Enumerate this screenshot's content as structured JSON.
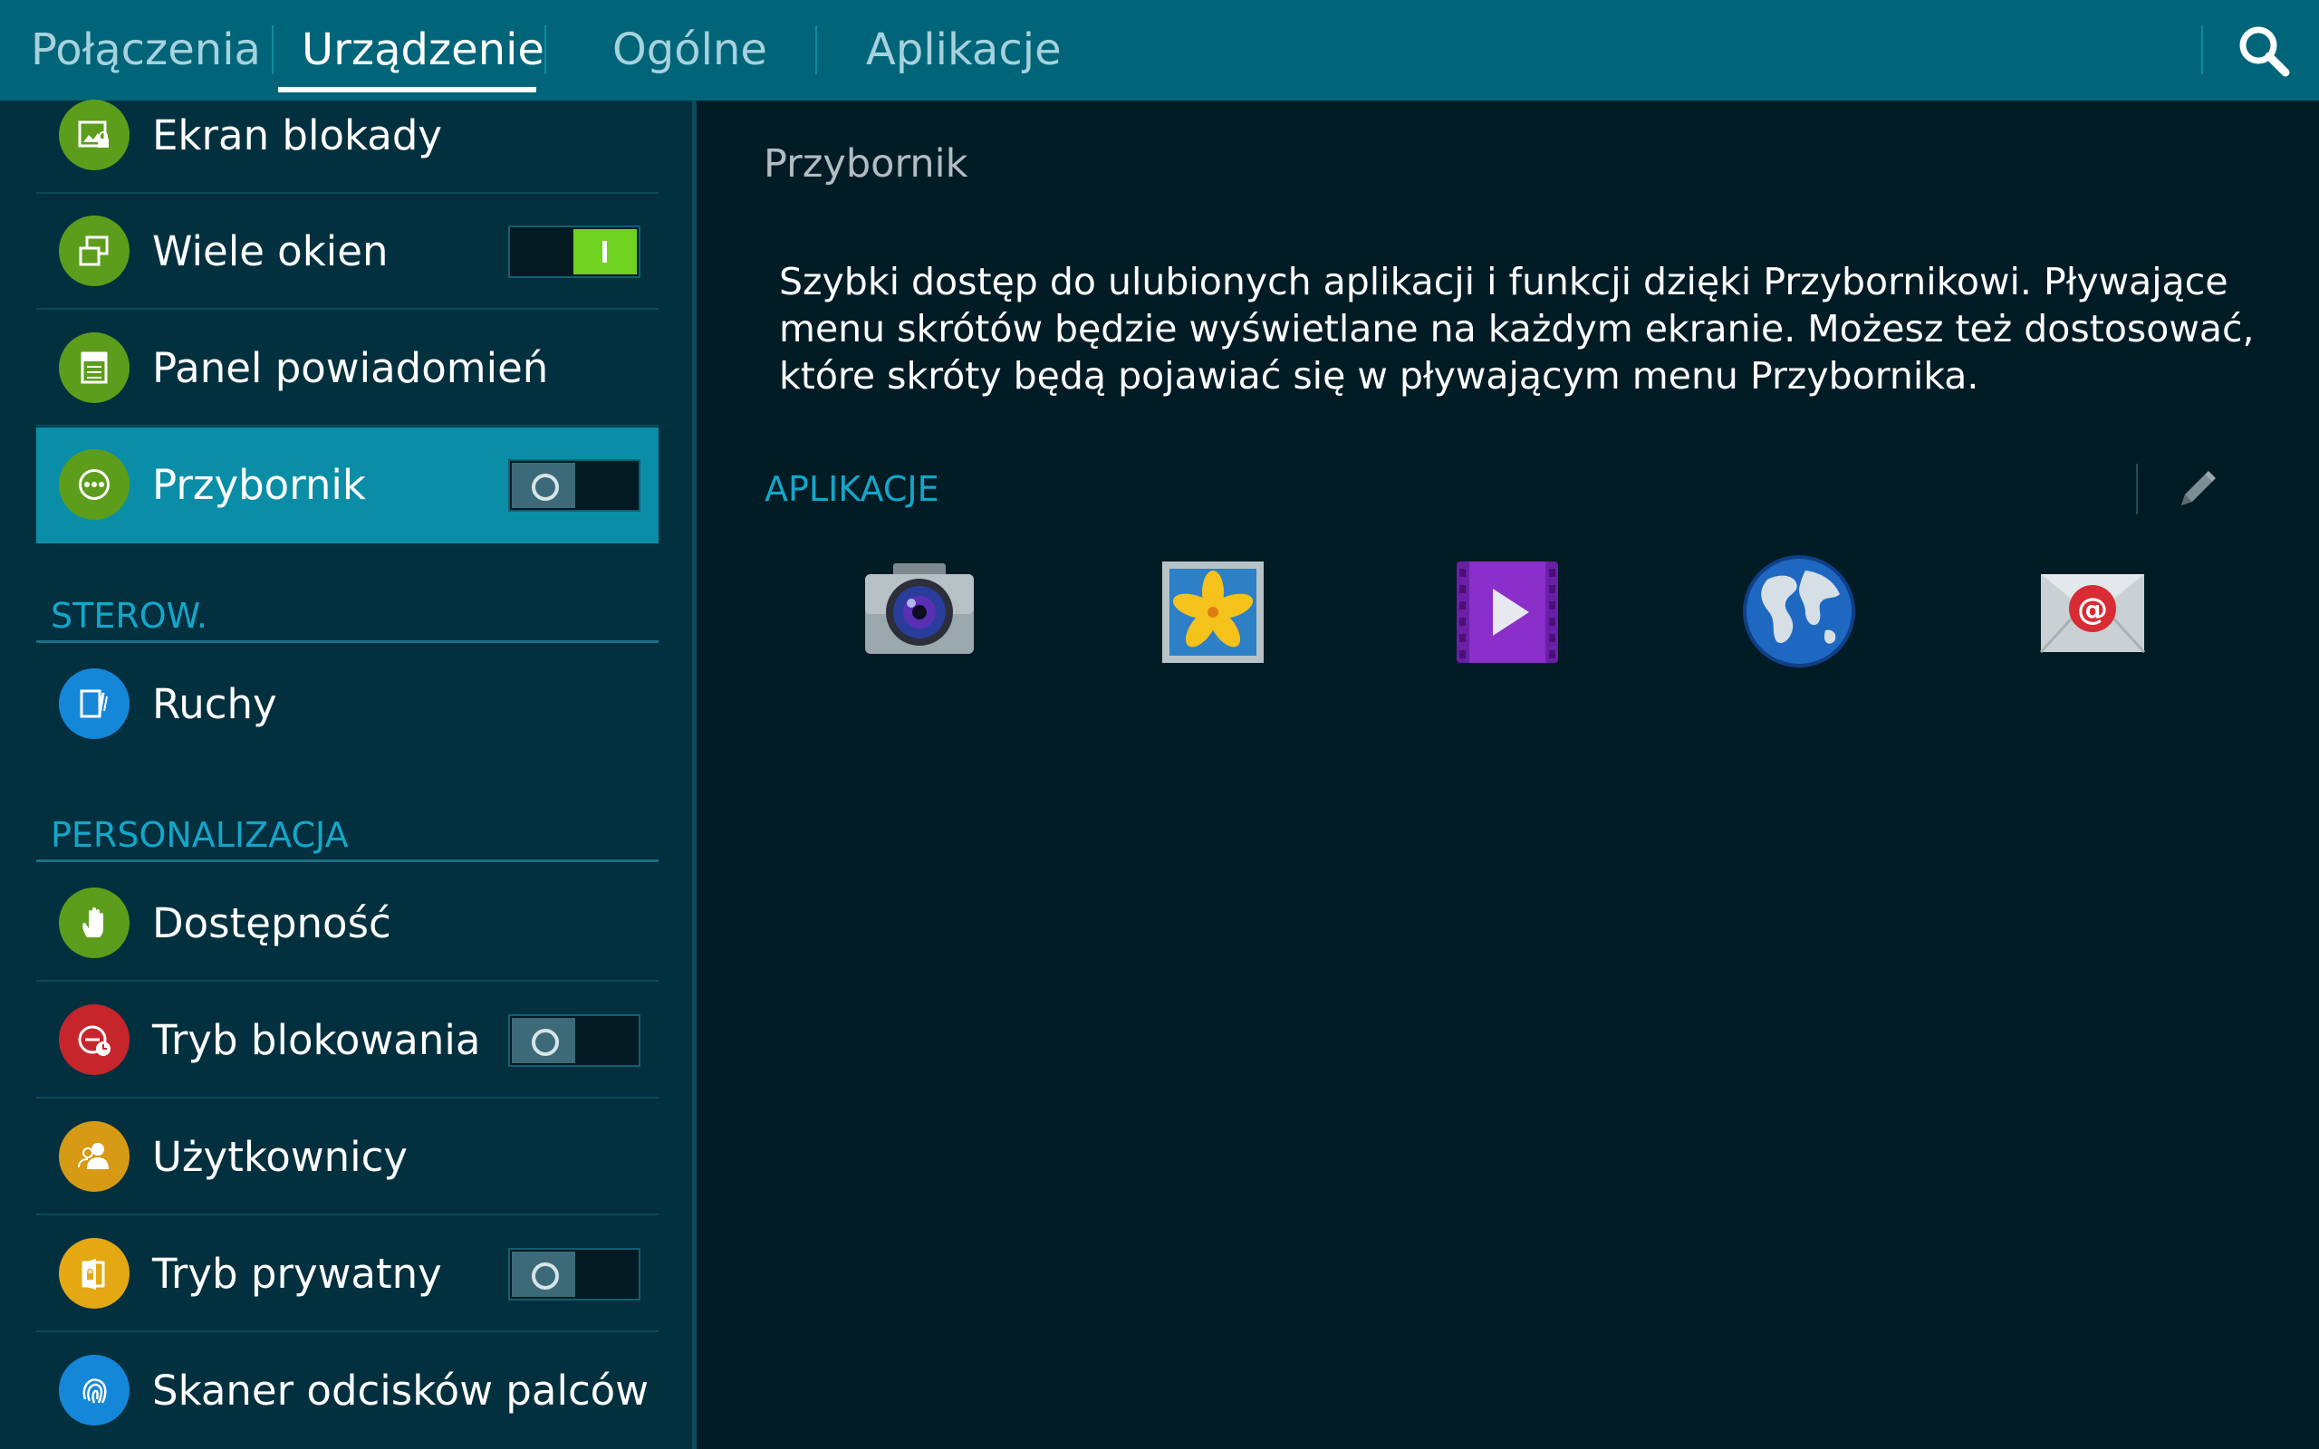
{
  "tabs": [
    {
      "label": "Połączenia",
      "active": false
    },
    {
      "label": "Urządzenie",
      "active": true
    },
    {
      "label": "Ogólne",
      "active": false
    },
    {
      "label": "Aplikacje",
      "active": false
    }
  ],
  "search": {
    "icon": "search-icon"
  },
  "sidebar": {
    "items": [
      {
        "label": "Ekran blokady",
        "icon": "lock-screen-icon",
        "icon_color": "#5c9d1c",
        "switch": null
      },
      {
        "label": "Wiele okien",
        "icon": "multi-window-icon",
        "icon_color": "#5c9d1c",
        "switch": "on"
      },
      {
        "label": "Panel powiadomień",
        "icon": "notification-panel-icon",
        "icon_color": "#5c9d1c",
        "switch": null
      },
      {
        "label": "Przybornik",
        "icon": "toolbox-icon",
        "icon_color": "#5c9d1c",
        "switch": "off",
        "selected": true
      }
    ],
    "section_control": "STEROW.",
    "control_items": [
      {
        "label": "Ruchy",
        "icon": "motion-icon",
        "icon_color": "#1587d8",
        "switch": null
      }
    ],
    "section_personal": "PERSONALIZACJA",
    "personal_items": [
      {
        "label": "Dostępność",
        "icon": "accessibility-hand-icon",
        "icon_color": "#5c9d1c",
        "switch": null
      },
      {
        "label": "Tryb blokowania",
        "icon": "blocking-mode-icon",
        "icon_color": "#c6262b",
        "switch": "off"
      },
      {
        "label": "Użytkownicy",
        "icon": "users-icon",
        "icon_color": "#d69a14",
        "switch": null
      },
      {
        "label": "Tryb prywatny",
        "icon": "private-mode-icon",
        "icon_color": "#e3a812",
        "switch": "off"
      },
      {
        "label": "Skaner odcisków palców",
        "icon": "fingerprint-icon",
        "icon_color": "#1587d8",
        "switch": null
      }
    ]
  },
  "main": {
    "title": "Przybornik",
    "description": "Szybki dostęp do ulubionych aplikacji i funkcji dzięki Przybornikowi. Pływające menu skrótów będzie wyświetlane na każdym ekranie. Możesz też dostosować, które skróty będą pojawiać się w pływającym menu Przybornika.",
    "apps_header": "APLIKACJE",
    "edit_icon": "pencil-icon",
    "apps": [
      "camera-icon",
      "gallery-icon",
      "video-icon",
      "browser-globe-icon",
      "email-icon"
    ]
  },
  "colors": {
    "topbar": "#006579",
    "accent": "#14a6c9",
    "selected_row": "#0a8ea8",
    "switch_on": "#6fd21e"
  }
}
